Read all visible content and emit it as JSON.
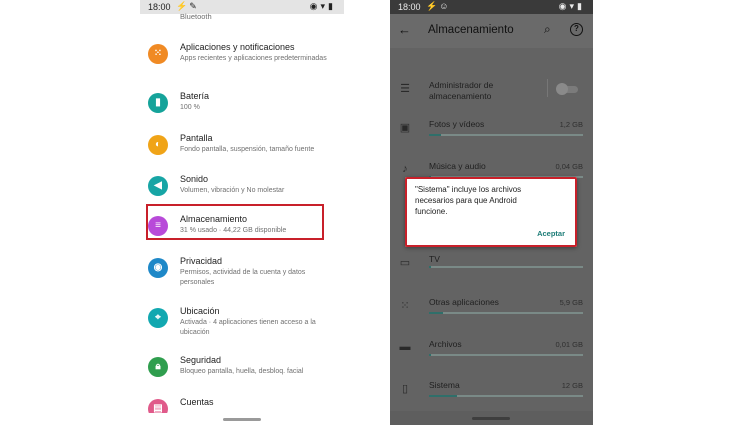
{
  "left": {
    "status": {
      "time": "18:00"
    },
    "top_partial": "Bluetooth",
    "items": [
      {
        "title": "Aplicaciones y notificaciones",
        "subtitle": "Apps recientes y aplicaciones predeterminadas",
        "icon": "apps-icon",
        "color": "#f08a24"
      },
      {
        "title": "Batería",
        "subtitle": "100 %",
        "icon": "battery-icon",
        "color": "#15a39a"
      },
      {
        "title": "Pantalla",
        "subtitle": "Fondo pantalla, suspensión, tamaño fuente",
        "icon": "display-icon",
        "color": "#f0a418"
      },
      {
        "title": "Sonido",
        "subtitle": "Volumen, vibración y No molestar",
        "icon": "sound-icon",
        "color": "#17a5a5"
      },
      {
        "title": "Almacenamiento",
        "subtitle": "31 % usado · 44,22 GB disponible",
        "icon": "storage-icon",
        "color": "#b84ad9"
      },
      {
        "title": "Privacidad",
        "subtitle": "Permisos, actividad de la cuenta y datos personales",
        "icon": "privacy-icon",
        "color": "#1e88c8"
      },
      {
        "title": "Ubicación",
        "subtitle": "Activada · 4 aplicaciones tienen acceso a la ubicación",
        "icon": "location-icon",
        "color": "#12a8b0"
      },
      {
        "title": "Seguridad",
        "subtitle": "Bloqueo pantalla, huella, desbloq. facial",
        "icon": "security-icon",
        "color": "#2f9e4e"
      },
      {
        "title": "Cuentas",
        "subtitle": "",
        "icon": "accounts-icon",
        "color": "#e05a8a"
      }
    ]
  },
  "right": {
    "status": {
      "time": "18:00"
    },
    "app_bar": {
      "title": "Almacenamiento"
    },
    "manager": {
      "label": "Administrador de almacenamiento"
    },
    "rows": [
      {
        "name": "Fotos y vídeos",
        "size": "1,2 GB",
        "fill": 0.08,
        "icon": "photos-icon"
      },
      {
        "name": "Música y audio",
        "size": "0,04 GB",
        "fill": 0.01,
        "icon": "music-icon"
      },
      {
        "name": "TV",
        "size": "",
        "fill": 0.01,
        "icon": "tv-icon"
      },
      {
        "name": "Otras aplicaciones",
        "size": "5,9 GB",
        "fill": 0.09,
        "icon": "apps-grid-icon"
      },
      {
        "name": "Archivos",
        "size": "0,01 GB",
        "fill": 0.01,
        "icon": "folder-icon"
      },
      {
        "name": "Sistema",
        "size": "12 GB",
        "fill": 0.18,
        "icon": "system-icon"
      }
    ],
    "dialog": {
      "message": "\"Sistema\" incluye los archivos necesarios para que Android funcione.",
      "button": "Aceptar"
    }
  },
  "colors": {
    "highlight": "#c8202a",
    "accent": "#1d7d78"
  }
}
